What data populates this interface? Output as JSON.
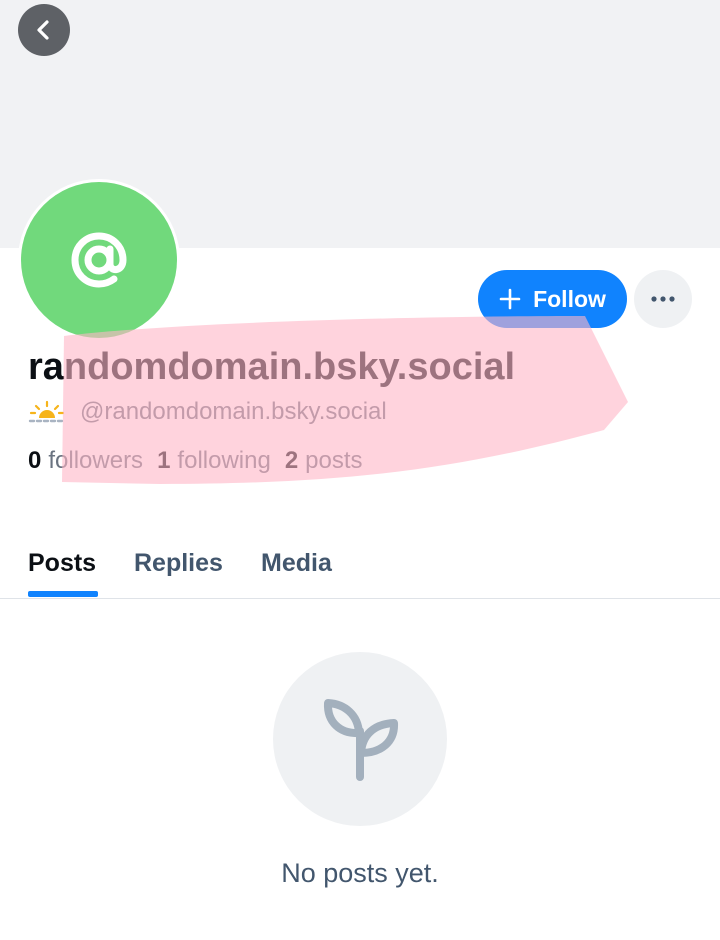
{
  "colors": {
    "banner": "#f1f2f4",
    "avatar": "#71d97c",
    "accent": "#1083fe",
    "redaction_mark": "#ffb6c6"
  },
  "header": {
    "back_icon": "chevron-left-icon"
  },
  "profile": {
    "avatar_icon": "at-sign-icon",
    "display_name": "randomdomain.bsky.social",
    "handle_badge_icon": "sunrise-icon",
    "handle": "@randomdomain.bsky.social",
    "follow_label": "Follow",
    "follow_icon": "plus-icon",
    "more_icon": "ellipsis-icon",
    "stats": {
      "followers_count": "0",
      "followers_label": "followers",
      "following_count": "1",
      "following_label": "following",
      "posts_count": "2",
      "posts_label": "posts"
    }
  },
  "tabs": [
    {
      "label": "Posts",
      "active": true
    },
    {
      "label": "Replies",
      "active": false
    },
    {
      "label": "Media",
      "active": false
    }
  ],
  "feed": {
    "empty_icon": "seedling-icon",
    "empty_text": "No posts yet."
  }
}
